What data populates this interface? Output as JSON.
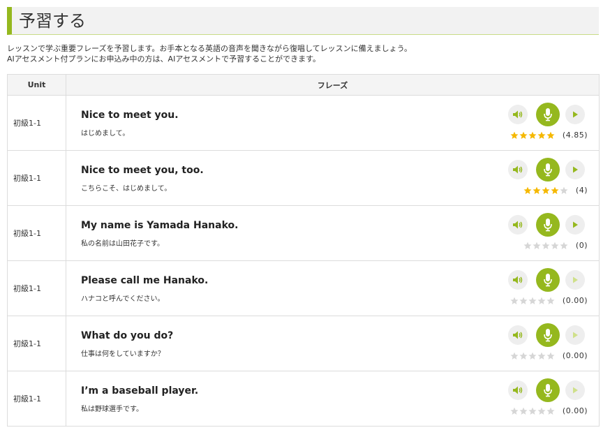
{
  "page": {
    "title": "予習する",
    "description_1": "レッスンで学ぶ重要フレーズを予習します。お手本となる英語の音声を聞きながら復唱してレッスンに備えましょう。",
    "description_2": "AIアセスメント付プランにお申込み中の方は、AIアセスメントで予習することができます。"
  },
  "colors": {
    "accent": "#95b81e",
    "star_on": "#f5b800",
    "star_off": "#d6d6d6",
    "play_active": "#95b81e",
    "play_inactive": "#cfe08a"
  },
  "icons": {
    "speaker": "speaker-icon",
    "mic": "microphone-icon",
    "play": "play-icon",
    "star": "star-icon"
  },
  "table": {
    "headers": {
      "unit": "Unit",
      "phrase": "フレーズ"
    },
    "rows": [
      {
        "unit": "初級1-1",
        "en": "Nice to meet you.",
        "ja": "はじめまして。",
        "stars": 5,
        "score": "(4.85)",
        "play_active": true
      },
      {
        "unit": "初級1-1",
        "en": "Nice to meet you, too.",
        "ja": "こちらこそ、はじめまして。",
        "stars": 4,
        "score": "(4)",
        "play_active": true
      },
      {
        "unit": "初級1-1",
        "en": "My name is Yamada Hanako.",
        "ja": "私の名前は山田花子です。",
        "stars": 0,
        "score": "(0)",
        "play_active": true
      },
      {
        "unit": "初級1-1",
        "en": "Please call me Hanako.",
        "ja": "ハナコと呼んでください。",
        "stars": 0,
        "score": "(0.00)",
        "play_active": false
      },
      {
        "unit": "初級1-1",
        "en": "What do you do?",
        "ja": "仕事は何をしていますか？",
        "stars": 0,
        "score": "(0.00)",
        "play_active": false
      },
      {
        "unit": "初級1-1",
        "en": "I’m a baseball player.",
        "ja": "私は野球選手です。",
        "stars": 0,
        "score": "(0.00)",
        "play_active": false
      }
    ]
  }
}
